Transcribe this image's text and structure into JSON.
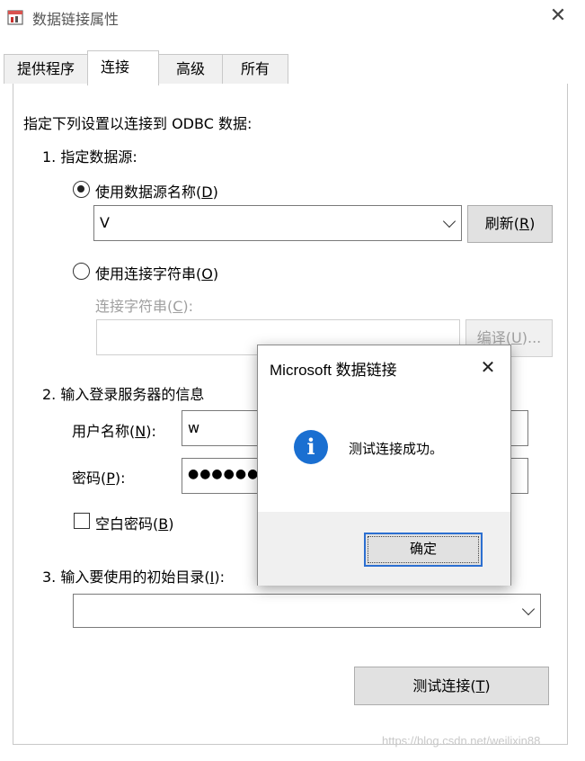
{
  "window": {
    "title": "数据链接属性",
    "close_glyph": "✕"
  },
  "tabs": [
    {
      "label": "提供程序",
      "active": false
    },
    {
      "label": "连接",
      "active": true
    },
    {
      "label": "高级",
      "active": false
    },
    {
      "label": "所有",
      "active": false
    }
  ],
  "connection": {
    "intro": "指定下列设置以连接到 ODBC 数据:",
    "step1": "1. 指定数据源:",
    "use_dsn": {
      "text": "使用数据源名称(",
      "key": "D",
      "suffix": ")",
      "selected": true
    },
    "dsn_value": "V",
    "refresh": {
      "text": "刷新(",
      "key": "R",
      "suffix": ")"
    },
    "use_conn_string": {
      "text": "使用连接字符串(",
      "key": "O",
      "suffix": ")",
      "selected": false
    },
    "conn_string_label": {
      "text": "连接字符串(",
      "key": "C",
      "suffix": "):"
    },
    "conn_string_value": "",
    "build": {
      "text": "编译(",
      "key": "U",
      "suffix": ")..."
    },
    "step2": "2. 输入登录服务器的信息",
    "username_label": {
      "text": "用户名称(",
      "key": "N",
      "suffix": "):"
    },
    "username_value": "w",
    "password_label": {
      "text": "密码(",
      "key": "P",
      "suffix": "):"
    },
    "password_value": "●●●●●●",
    "blank_password": {
      "text": "空白密码(",
      "key": "B",
      "suffix": ")",
      "checked": false
    },
    "step3": {
      "text": "3. 输入要使用的初始目录(",
      "key": "I",
      "suffix": "):"
    },
    "catalog_value": "",
    "test": {
      "text": "测试连接(",
      "key": "T",
      "suffix": ")"
    }
  },
  "message_box": {
    "title": "Microsoft 数据链接",
    "close_glyph": "✕",
    "icon": "info-icon",
    "icon_glyph": "i",
    "message": "测试连接成功。",
    "ok_label": "确定"
  },
  "watermark": "https://blog.csdn.net/weilixin88",
  "colors": {
    "accent": "#1a6fd1",
    "focus_border": "#2c6fd1",
    "button_face": "#e1e1e1",
    "disabled_text": "#a0a0a0"
  }
}
